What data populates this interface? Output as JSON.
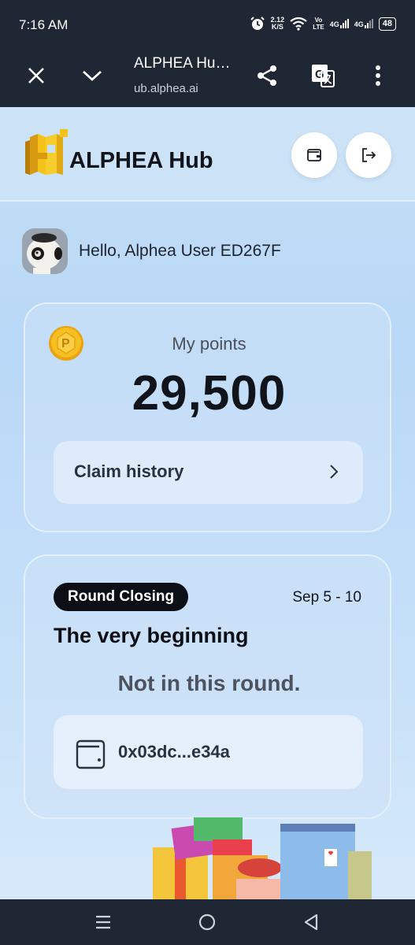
{
  "status_bar": {
    "time": "7:16 AM",
    "speed_value": "2.12",
    "speed_unit": "K/S",
    "volte_top": "Vo",
    "volte_bottom": "LTE",
    "signal1_label": "4G",
    "signal2_label": "4G",
    "battery": "48"
  },
  "browser": {
    "title": "ALPHEA Hu…",
    "url": "ub.alphea.ai"
  },
  "header": {
    "title": "ALPHEA Hub"
  },
  "user": {
    "greeting": "Hello, Alphea User ED267F"
  },
  "points": {
    "label": "My points",
    "value": "29,500",
    "claim_history_label": "Claim history"
  },
  "round": {
    "status_badge": "Round Closing",
    "dates": "Sep 5 - 10",
    "title": "The very beginning",
    "participation": "Not in this round.",
    "wallet_address": "0x03dc...e34a"
  },
  "colors": {
    "accent_dark": "#0d0f16",
    "background_blue": "#b9d8f7",
    "coin_gold": "#f2b51e",
    "logo_yellow": "#f5c21a"
  }
}
